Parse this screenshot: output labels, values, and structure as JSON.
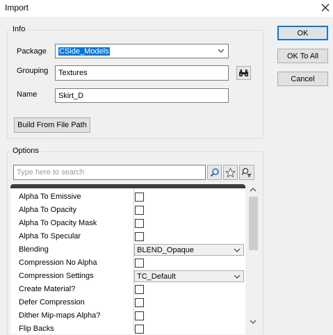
{
  "window": {
    "title": "Import"
  },
  "info": {
    "label": "Info",
    "package_label": "Package",
    "package_value": "CSide_Models",
    "grouping_label": "Grouping",
    "grouping_value": "Textures",
    "name_label": "Name",
    "name_value": "Skirt_D",
    "build_button": "Build From File Path"
  },
  "buttons": {
    "ok": "OK",
    "ok_to_all": "OK To All",
    "cancel": "Cancel"
  },
  "options": {
    "label": "Options",
    "search_placeholder": "Type here to search",
    "rows": [
      {
        "label": "Alpha To Emissive",
        "type": "checkbox",
        "checked": false
      },
      {
        "label": "Alpha To Opacity",
        "type": "checkbox",
        "checked": false
      },
      {
        "label": "Alpha To Opacity Mask",
        "type": "checkbox",
        "checked": false
      },
      {
        "label": "Alpha To Specular",
        "type": "checkbox",
        "checked": false
      },
      {
        "label": "Blending",
        "type": "combo",
        "value": "BLEND_Opaque"
      },
      {
        "label": "Compression No Alpha",
        "type": "checkbox",
        "checked": false
      },
      {
        "label": "Compression Settings",
        "type": "combo",
        "value": "TC_Default"
      },
      {
        "label": "Create Material?",
        "type": "checkbox",
        "checked": false
      },
      {
        "label": "Defer Compression",
        "type": "checkbox",
        "checked": false
      },
      {
        "label": "Dither Mip-maps Alpha?",
        "type": "checkbox",
        "checked": false
      },
      {
        "label": "Flip Backs",
        "type": "checkbox",
        "checked": false
      }
    ]
  },
  "icons": {
    "binoculars": "binoculars-icon",
    "search": "magnifier-icon",
    "favorite": "star-icon",
    "filter": "filter-icon"
  }
}
